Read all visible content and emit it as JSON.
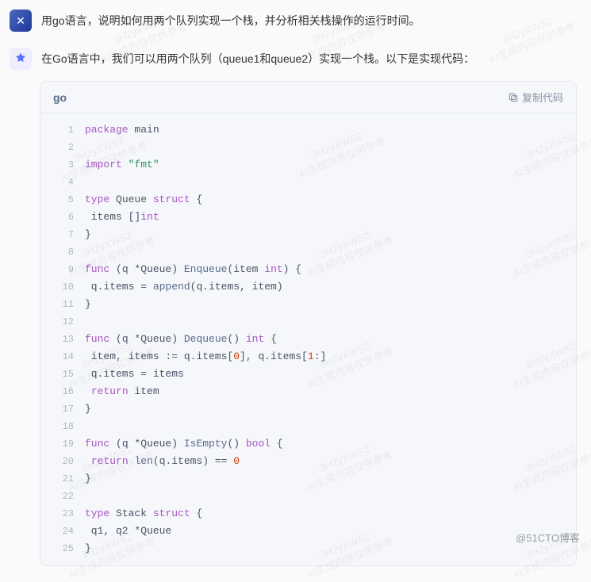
{
  "question": "用go语言，说明如何用两个队列实现一个栈，并分析相关栈操作的运行时间。",
  "answer_intro": "在Go语言中，我们可以用两个队列（queue1和queue2）实现一个栈。以下是实现代码：",
  "code_block": {
    "language": "go",
    "copy_label": "复制代码",
    "lines": [
      [
        {
          "t": "package",
          "c": "kw"
        },
        {
          "t": " main",
          "c": "id"
        }
      ],
      [],
      [
        {
          "t": "import",
          "c": "kw"
        },
        {
          "t": " ",
          "c": "op"
        },
        {
          "t": "\"fmt\"",
          "c": "str"
        }
      ],
      [],
      [
        {
          "t": "type",
          "c": "kw"
        },
        {
          "t": " Queue ",
          "c": "nm"
        },
        {
          "t": "struct",
          "c": "kw"
        },
        {
          "t": " {",
          "c": "op"
        }
      ],
      [
        {
          "t": " items []",
          "c": "id"
        },
        {
          "t": "int",
          "c": "typ"
        }
      ],
      [
        {
          "t": "}",
          "c": "op"
        }
      ],
      [],
      [
        {
          "t": "func",
          "c": "kw"
        },
        {
          "t": " (q *Queue) ",
          "c": "id"
        },
        {
          "t": "Enqueue",
          "c": "fn"
        },
        {
          "t": "(item ",
          "c": "id"
        },
        {
          "t": "int",
          "c": "typ"
        },
        {
          "t": ") {",
          "c": "op"
        }
      ],
      [
        {
          "t": " q.items = ",
          "c": "id"
        },
        {
          "t": "append",
          "c": "fn"
        },
        {
          "t": "(q.items, item)",
          "c": "id"
        }
      ],
      [
        {
          "t": "}",
          "c": "op"
        }
      ],
      [],
      [
        {
          "t": "func",
          "c": "kw"
        },
        {
          "t": " (q *Queue) ",
          "c": "id"
        },
        {
          "t": "Dequeue",
          "c": "fn"
        },
        {
          "t": "() ",
          "c": "op"
        },
        {
          "t": "int",
          "c": "typ"
        },
        {
          "t": " {",
          "c": "op"
        }
      ],
      [
        {
          "t": " item, items := q.items[",
          "c": "id"
        },
        {
          "t": "0",
          "c": "num"
        },
        {
          "t": "], q.items[",
          "c": "id"
        },
        {
          "t": "1",
          "c": "num"
        },
        {
          "t": ":]",
          "c": "id"
        }
      ],
      [
        {
          "t": " q.items = items",
          "c": "id"
        }
      ],
      [
        {
          "t": " ",
          "c": "op"
        },
        {
          "t": "return",
          "c": "kw"
        },
        {
          "t": " item",
          "c": "id"
        }
      ],
      [
        {
          "t": "}",
          "c": "op"
        }
      ],
      [],
      [
        {
          "t": "func",
          "c": "kw"
        },
        {
          "t": " (q *Queue) ",
          "c": "id"
        },
        {
          "t": "IsEmpty",
          "c": "fn"
        },
        {
          "t": "() ",
          "c": "op"
        },
        {
          "t": "bool",
          "c": "typ"
        },
        {
          "t": " {",
          "c": "op"
        }
      ],
      [
        {
          "t": " ",
          "c": "op"
        },
        {
          "t": "return",
          "c": "kw"
        },
        {
          "t": " ",
          "c": "op"
        },
        {
          "t": "len",
          "c": "fn"
        },
        {
          "t": "(q.items) == ",
          "c": "id"
        },
        {
          "t": "0",
          "c": "num"
        }
      ],
      [
        {
          "t": "}",
          "c": "op"
        }
      ],
      [],
      [
        {
          "t": "type",
          "c": "kw"
        },
        {
          "t": " Stack ",
          "c": "nm"
        },
        {
          "t": "struct",
          "c": "kw"
        },
        {
          "t": " {",
          "c": "op"
        }
      ],
      [
        {
          "t": " q1, q2 *Queue",
          "c": "id"
        }
      ],
      [
        {
          "t": "}",
          "c": "op"
        }
      ]
    ]
  },
  "watermark": {
    "line1": "3H2yXWS2",
    "line2": "AI生成内容仅供参考"
  },
  "footer": "@51CTO博客"
}
